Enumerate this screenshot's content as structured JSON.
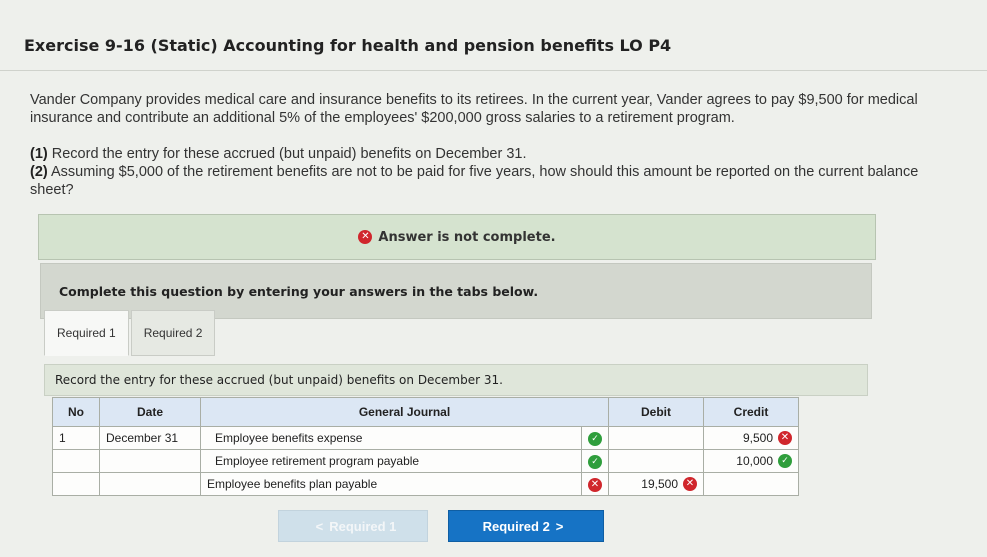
{
  "exercise": {
    "title": "Exercise 9-16 (Static) Accounting for health and pension benefits LO P4",
    "paragraph1": "Vander Company provides medical care and insurance benefits to its retirees. In the current year, Vander agrees to pay $9,500 for medical insurance and contribute an additional 5% of the employees' $200,000 gross salaries to a retirement program.",
    "req1_prefix": "(1)",
    "req1_text": " Record the entry for these accrued (but unpaid) benefits on December 31.",
    "req2_prefix": "(2)",
    "req2_text": " Assuming $5,000 of the retirement benefits are not to be paid for five years, how should this amount be reported on the current balance sheet?"
  },
  "status_banner": {
    "text": "Answer is not complete.",
    "icon": "x-circle-icon",
    "color": "#d0262c"
  },
  "instructions": "Complete this question by entering your answers in the tabs below.",
  "tabs": [
    {
      "label": "Required 1",
      "active": true
    },
    {
      "label": "Required 2",
      "active": false
    }
  ],
  "panel_prompt": "Record the entry for these accrued (but unpaid) benefits on December 31.",
  "journal": {
    "headers": {
      "no": "No",
      "date": "Date",
      "account": "General Journal",
      "debit": "Debit",
      "credit": "Credit"
    },
    "rows": [
      {
        "no": "1",
        "date": "December 31",
        "account": "Employee benefits expense",
        "account_status": "correct",
        "debit": "",
        "debit_status": "",
        "credit": "9,500",
        "credit_status": "incorrect"
      },
      {
        "no": "",
        "date": "",
        "account": "Employee retirement program payable",
        "account_status": "correct",
        "debit": "",
        "debit_status": "",
        "credit": "10,000",
        "credit_status": "correct"
      },
      {
        "no": "",
        "date": "",
        "account": "Employee benefits plan payable",
        "account_status": "incorrect",
        "debit": "19,500",
        "debit_status": "incorrect",
        "credit": "",
        "credit_status": ""
      }
    ]
  },
  "nav": {
    "prev_label": "Required 1",
    "next_label": "Required 2",
    "prev_arrow": "<",
    "next_arrow": ">",
    "accent": "#1673c5"
  }
}
